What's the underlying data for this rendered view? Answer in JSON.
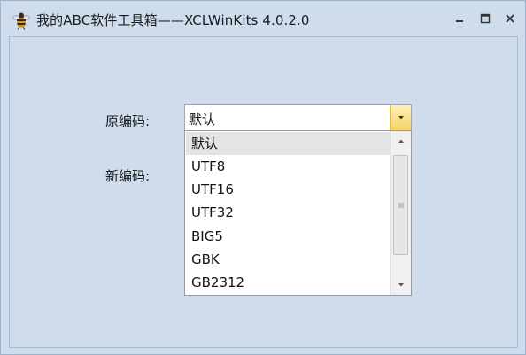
{
  "window": {
    "title": "我的ABC软件工具箱——XCLWinKits  4.0.2.0",
    "icon": "bee-app-icon"
  },
  "form": {
    "source_label": "原编码:",
    "target_label": "新编码:",
    "source_value": "默认"
  },
  "dropdown": {
    "options": [
      "默认",
      "UTF8",
      "UTF16",
      "UTF32",
      "BIG5",
      "GBK",
      "GB2312"
    ],
    "selected_index": 0
  },
  "colors": {
    "background": "#cfdcec",
    "combo_button": "#f6d468",
    "selected_option": "#e4e4e4"
  }
}
